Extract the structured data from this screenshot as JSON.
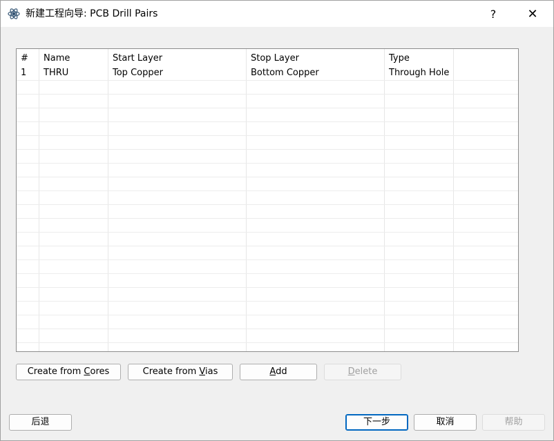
{
  "window": {
    "title": "新建工程向导: PCB Drill Pairs",
    "help_glyph": "?",
    "close_glyph": "✕"
  },
  "table": {
    "columns": [
      "#",
      "Name",
      "Start Layer",
      "Stop Layer",
      "Type"
    ],
    "rows": [
      [
        "1",
        "THRU",
        "Top Copper",
        "Bottom Copper",
        "Through Hole"
      ]
    ]
  },
  "actions": {
    "create_cores": {
      "pre": "Create from ",
      "u": "C",
      "post": "ores"
    },
    "create_vias": {
      "pre": "Create from ",
      "u": "V",
      "post": "ias"
    },
    "add": {
      "pre": "",
      "u": "A",
      "post": "dd"
    },
    "delete": {
      "pre": "",
      "u": "D",
      "post": "elete"
    }
  },
  "footer": {
    "back": "后退",
    "next": "下一步",
    "cancel": "取消",
    "help": "帮助"
  }
}
